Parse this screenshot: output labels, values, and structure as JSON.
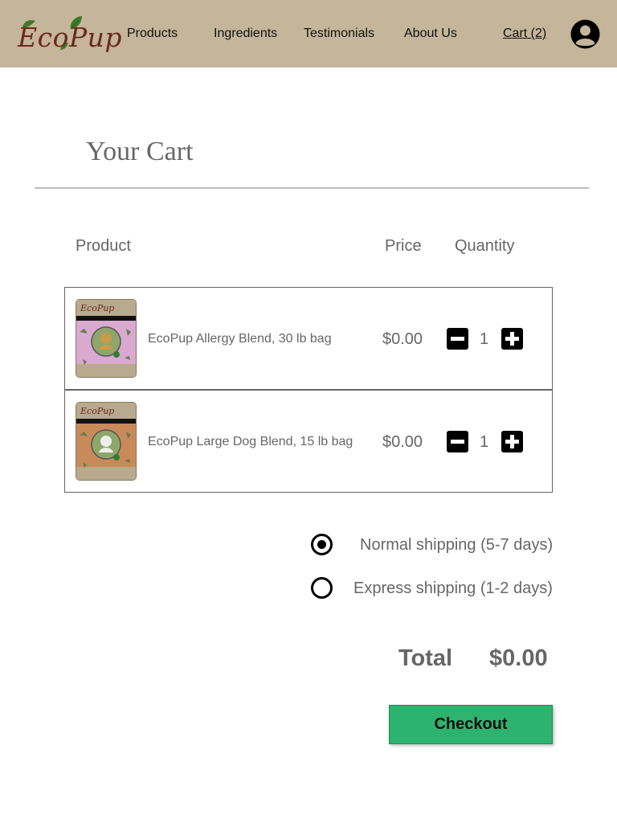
{
  "header": {
    "logo_text": "EcoPup",
    "nav": [
      "Products",
      "Ingredients",
      "Testimonials",
      "About Us"
    ],
    "cart_label": "Cart (2)"
  },
  "page_title": "Your Cart",
  "columns": {
    "product": "Product",
    "price": "Price",
    "quantity": "Quantity"
  },
  "cart": {
    "items": [
      {
        "name": "EcoPup Allergy Blend, 30 lb bag",
        "price": "$0.00",
        "quantity": "1",
        "package_color": "#d9a9cf"
      },
      {
        "name": "EcoPup Large Dog Blend, 15 lb bag",
        "price": "$0.00",
        "quantity": "1",
        "package_color": "#c98a5a"
      }
    ]
  },
  "shipping": {
    "options": [
      {
        "label": "Normal shipping (5-7 days)",
        "selected": true
      },
      {
        "label": "Express shipping (1-2 days)",
        "selected": false
      }
    ]
  },
  "total": {
    "label": "Total",
    "value": "$0.00"
  },
  "checkout_label": "Checkout",
  "colors": {
    "header_bg": "#c4b59b",
    "checkout_bg": "#2eb36f",
    "logo": "#6b2a1a"
  }
}
